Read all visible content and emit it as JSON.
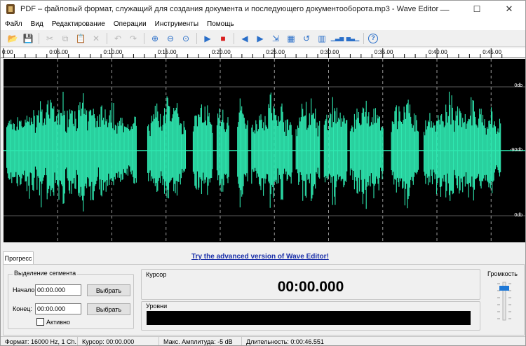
{
  "window": {
    "title": "PDF – файловый формат, служащий для создания документа и последующего документооборота.mp3 - Wave Editor"
  },
  "menu": [
    "Файл",
    "Вид",
    "Редактирование",
    "Операции",
    "Инструменты",
    "Помощь"
  ],
  "toolbar": [
    {
      "icon": "open-folder-icon",
      "glyph": "📂",
      "state": "enabled"
    },
    {
      "icon": "save-icon",
      "glyph": "💾",
      "state": "enabled"
    },
    {
      "sep": true
    },
    {
      "icon": "cut-icon",
      "glyph": "✂",
      "state": "disabled"
    },
    {
      "icon": "copy-icon",
      "glyph": "⧉",
      "state": "disabled"
    },
    {
      "icon": "paste-icon",
      "glyph": "📋",
      "state": "disabled"
    },
    {
      "icon": "delete-icon",
      "glyph": "✕",
      "state": "disabled"
    },
    {
      "sep": true
    },
    {
      "icon": "undo-icon",
      "glyph": "↶",
      "state": "disabled"
    },
    {
      "icon": "redo-icon",
      "glyph": "↷",
      "state": "disabled"
    },
    {
      "sep": true
    },
    {
      "icon": "zoom-in-icon",
      "glyph": "⊕",
      "state": "enabled"
    },
    {
      "icon": "zoom-out-icon",
      "glyph": "⊖",
      "state": "enabled"
    },
    {
      "icon": "zoom-fit-icon",
      "glyph": "⊙",
      "state": "enabled"
    },
    {
      "sep": true
    },
    {
      "icon": "play-icon",
      "glyph": "▶",
      "state": "enabled"
    },
    {
      "icon": "stop-icon",
      "glyph": "■",
      "state": "stop"
    },
    {
      "sep": true
    },
    {
      "icon": "fade-in-icon",
      "glyph": "◀",
      "state": "enabled"
    },
    {
      "icon": "fade-out-icon",
      "glyph": "▶",
      "state": "enabled"
    },
    {
      "icon": "trim-icon",
      "glyph": "⇲",
      "state": "enabled"
    },
    {
      "icon": "amplify-icon",
      "glyph": "▦",
      "state": "enabled"
    },
    {
      "icon": "reverse-icon",
      "glyph": "↺",
      "state": "enabled"
    },
    {
      "icon": "normalize-icon",
      "glyph": "▥",
      "state": "enabled"
    },
    {
      "icon": "equalizer-icon",
      "glyph": "▁▃▅",
      "state": "enabled"
    },
    {
      "icon": "spectrum-icon",
      "glyph": "▅▃▁",
      "state": "enabled"
    },
    {
      "sep": true
    },
    {
      "icon": "help-icon",
      "glyph": "?",
      "state": "help"
    }
  ],
  "ruler": {
    "ticks": [
      "0:00",
      "0:05.00",
      "0:10.00",
      "0:15.00",
      "0:20.00",
      "0:25.00",
      "0:30.00",
      "0:35.00",
      "0:40.00",
      "0:45.00"
    ]
  },
  "waveform": {
    "duration_seconds": 46.551,
    "color": "#2ee8b0",
    "background": "#000000",
    "db_labels": [
      "0db",
      "-90db",
      "0db"
    ],
    "speech_segments_seconds": [
      [
        0.3,
        12.3
      ],
      [
        13.3,
        16.8
      ],
      [
        17.5,
        19.3
      ],
      [
        19.7,
        20.8
      ],
      [
        21.6,
        22.6
      ],
      [
        22.9,
        26.7
      ],
      [
        27.0,
        29.2
      ],
      [
        29.6,
        31.7
      ],
      [
        32.0,
        35.1
      ],
      [
        35.8,
        38.3
      ],
      [
        38.8,
        45.9
      ]
    ],
    "amplitude_fraction": 0.38
  },
  "tabs": {
    "progress": "Прогресс"
  },
  "promo": "Try the advanced version of Wave Editor!",
  "segment": {
    "group_title": "Выделение сегмента",
    "start_label": "Начало:",
    "start_value": "00:00.000",
    "end_label": "Конец:",
    "end_value": "00:00.000",
    "select_start_label": "Выбрать",
    "select_end_label": "Выбрать",
    "active_label": "Активно",
    "active_checked": false
  },
  "cursor": {
    "group_title": "Курсор",
    "value": "00:00.000"
  },
  "levels": {
    "group_title": "Уровни"
  },
  "volume": {
    "group_title": "Громкость"
  },
  "status": {
    "format": "Формат: 16000 Hz, 1 Ch.",
    "cursor": "Курсор: 00:00.000",
    "max_amplitude": "Макс. Амплитуда: -5 dB",
    "duration": "Длительность: 0:00:46.551"
  }
}
